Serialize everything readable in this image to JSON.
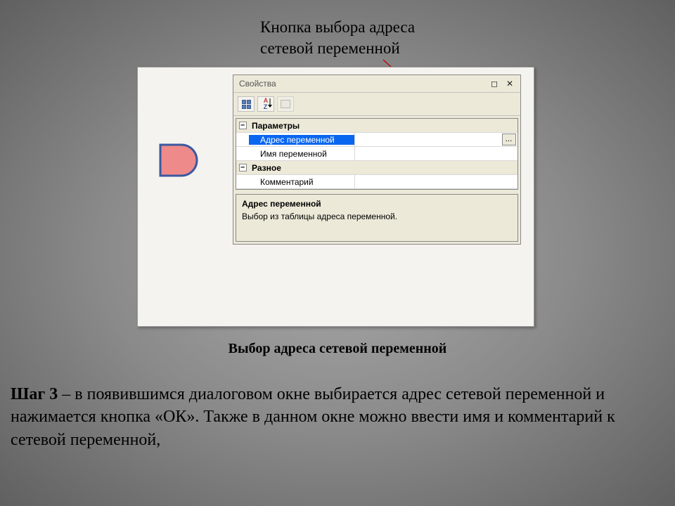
{
  "annotation": {
    "line1": "Кнопка выбора адреса",
    "line2": "сетевой переменной"
  },
  "panel": {
    "title": "Свойства",
    "groups": {
      "parameters": {
        "label": "Параметры",
        "expand": "⊟"
      },
      "misc": {
        "label": "Разное",
        "expand": "⊟"
      }
    },
    "rows": {
      "var_address": {
        "label": "Адрес переменной",
        "value": ""
      },
      "var_name": {
        "label": "Имя переменной",
        "value": ""
      },
      "comment": {
        "label": "Комментарий",
        "value": ""
      }
    },
    "description": {
      "title": "Адрес переменной",
      "text": "Выбор из таблицы адреса переменной."
    },
    "ellipsis": "..."
  },
  "caption": "Выбор адреса сетевой переменной",
  "step": {
    "prefix": "Шаг 3",
    "text": " – в появившимся диалоговом окне выбирается адрес сетевой переменной и нажимается кнопка «ОК». Также в данном окне можно ввести имя и комментарий к сетевой переменной,"
  }
}
